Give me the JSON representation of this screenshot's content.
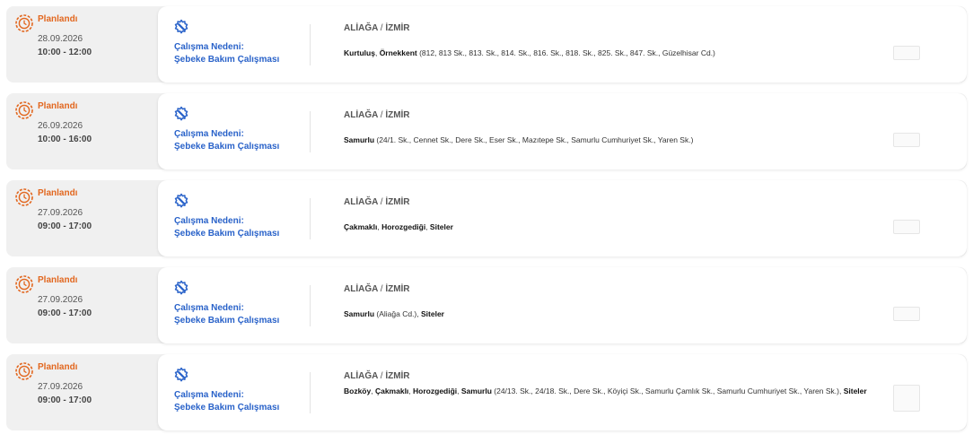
{
  "outages": [
    {
      "status": "Planlandı",
      "date": "28.09.2026",
      "time": "10:00 - 12:00",
      "reason_title": "Çalışma Nedeni:",
      "reason": "Şebeke Bakım Çalışması",
      "district": "ALİAĞA",
      "separator": "/",
      "city": "İZMİR",
      "streets": [
        {
          "name": "Kurtuluş",
          "sep": ", "
        },
        {
          "name": "Örnekkent",
          "detail": " (812, 813 Sk., 813. Sk., 814. Sk., 816. Sk., 818. Sk., 825. Sk., 847. Sk., Güzelhisar Cd.)",
          "sep": ""
        }
      ]
    },
    {
      "status": "Planlandı",
      "date": "26.09.2026",
      "time": "10:00 - 16:00",
      "reason_title": "Çalışma Nedeni:",
      "reason": "Şebeke Bakım Çalışması",
      "district": "ALİAĞA",
      "separator": "/",
      "city": "İZMİR",
      "streets": [
        {
          "name": "Samurlu",
          "detail": " (24/1. Sk., Cennet Sk., Dere Sk., Eser Sk., Mazıtepe Sk., Samurlu Cumhuriyet Sk., Yaren Sk.)",
          "sep": ""
        }
      ]
    },
    {
      "status": "Planlandı",
      "date": "27.09.2026",
      "time": "09:00 - 17:00",
      "reason_title": "Çalışma Nedeni:",
      "reason": "Şebeke Bakım Çalışması",
      "district": "ALİAĞA",
      "separator": "/",
      "city": "İZMİR",
      "streets": [
        {
          "name": "Çakmaklı",
          "sep": ", "
        },
        {
          "name": "Horozgediği",
          "sep": ", "
        },
        {
          "name": "Siteler",
          "sep": ""
        }
      ]
    },
    {
      "status": "Planlandı",
      "date": "27.09.2026",
      "time": "09:00 - 17:00",
      "reason_title": "Çalışma Nedeni:",
      "reason": "Şebeke Bakım Çalışması",
      "district": "ALİAĞA",
      "separator": "/",
      "city": "İZMİR",
      "streets": [
        {
          "name": "Samurlu",
          "detail": " (Aliağa Cd.)",
          "sep": ", "
        },
        {
          "name": "Siteler",
          "sep": ""
        }
      ]
    },
    {
      "status": "Planlandı",
      "date": "27.09.2026",
      "time": "09:00 - 17:00",
      "reason_title": "Çalışma Nedeni:",
      "reason": "Şebeke Bakım Çalışması",
      "district": "ALİAĞA",
      "separator": "/",
      "city": "İZMİR",
      "tall": true,
      "streets": [
        {
          "name": "Bozköy",
          "sep": ", "
        },
        {
          "name": "Çakmaklı",
          "sep": ", "
        },
        {
          "name": "Horozgediği",
          "sep": ", "
        },
        {
          "name": "Samurlu",
          "detail": " (24/13. Sk., 24/18. Sk., Dere Sk., Köyiçi Sk., Samurlu Çamlık Sk., Samurlu Cumhuriyet Sk., Yaren Sk.)",
          "sep": ", "
        },
        {
          "name": "Siteler",
          "sep": ""
        }
      ]
    }
  ],
  "colors": {
    "status": "#e2671f",
    "reason": "#2962c9",
    "row_bg": "#f0f0f0",
    "card_bg": "#ffffff"
  },
  "icons": {
    "status": "gear-clock-icon",
    "reason": "gear-wrench-icon"
  }
}
